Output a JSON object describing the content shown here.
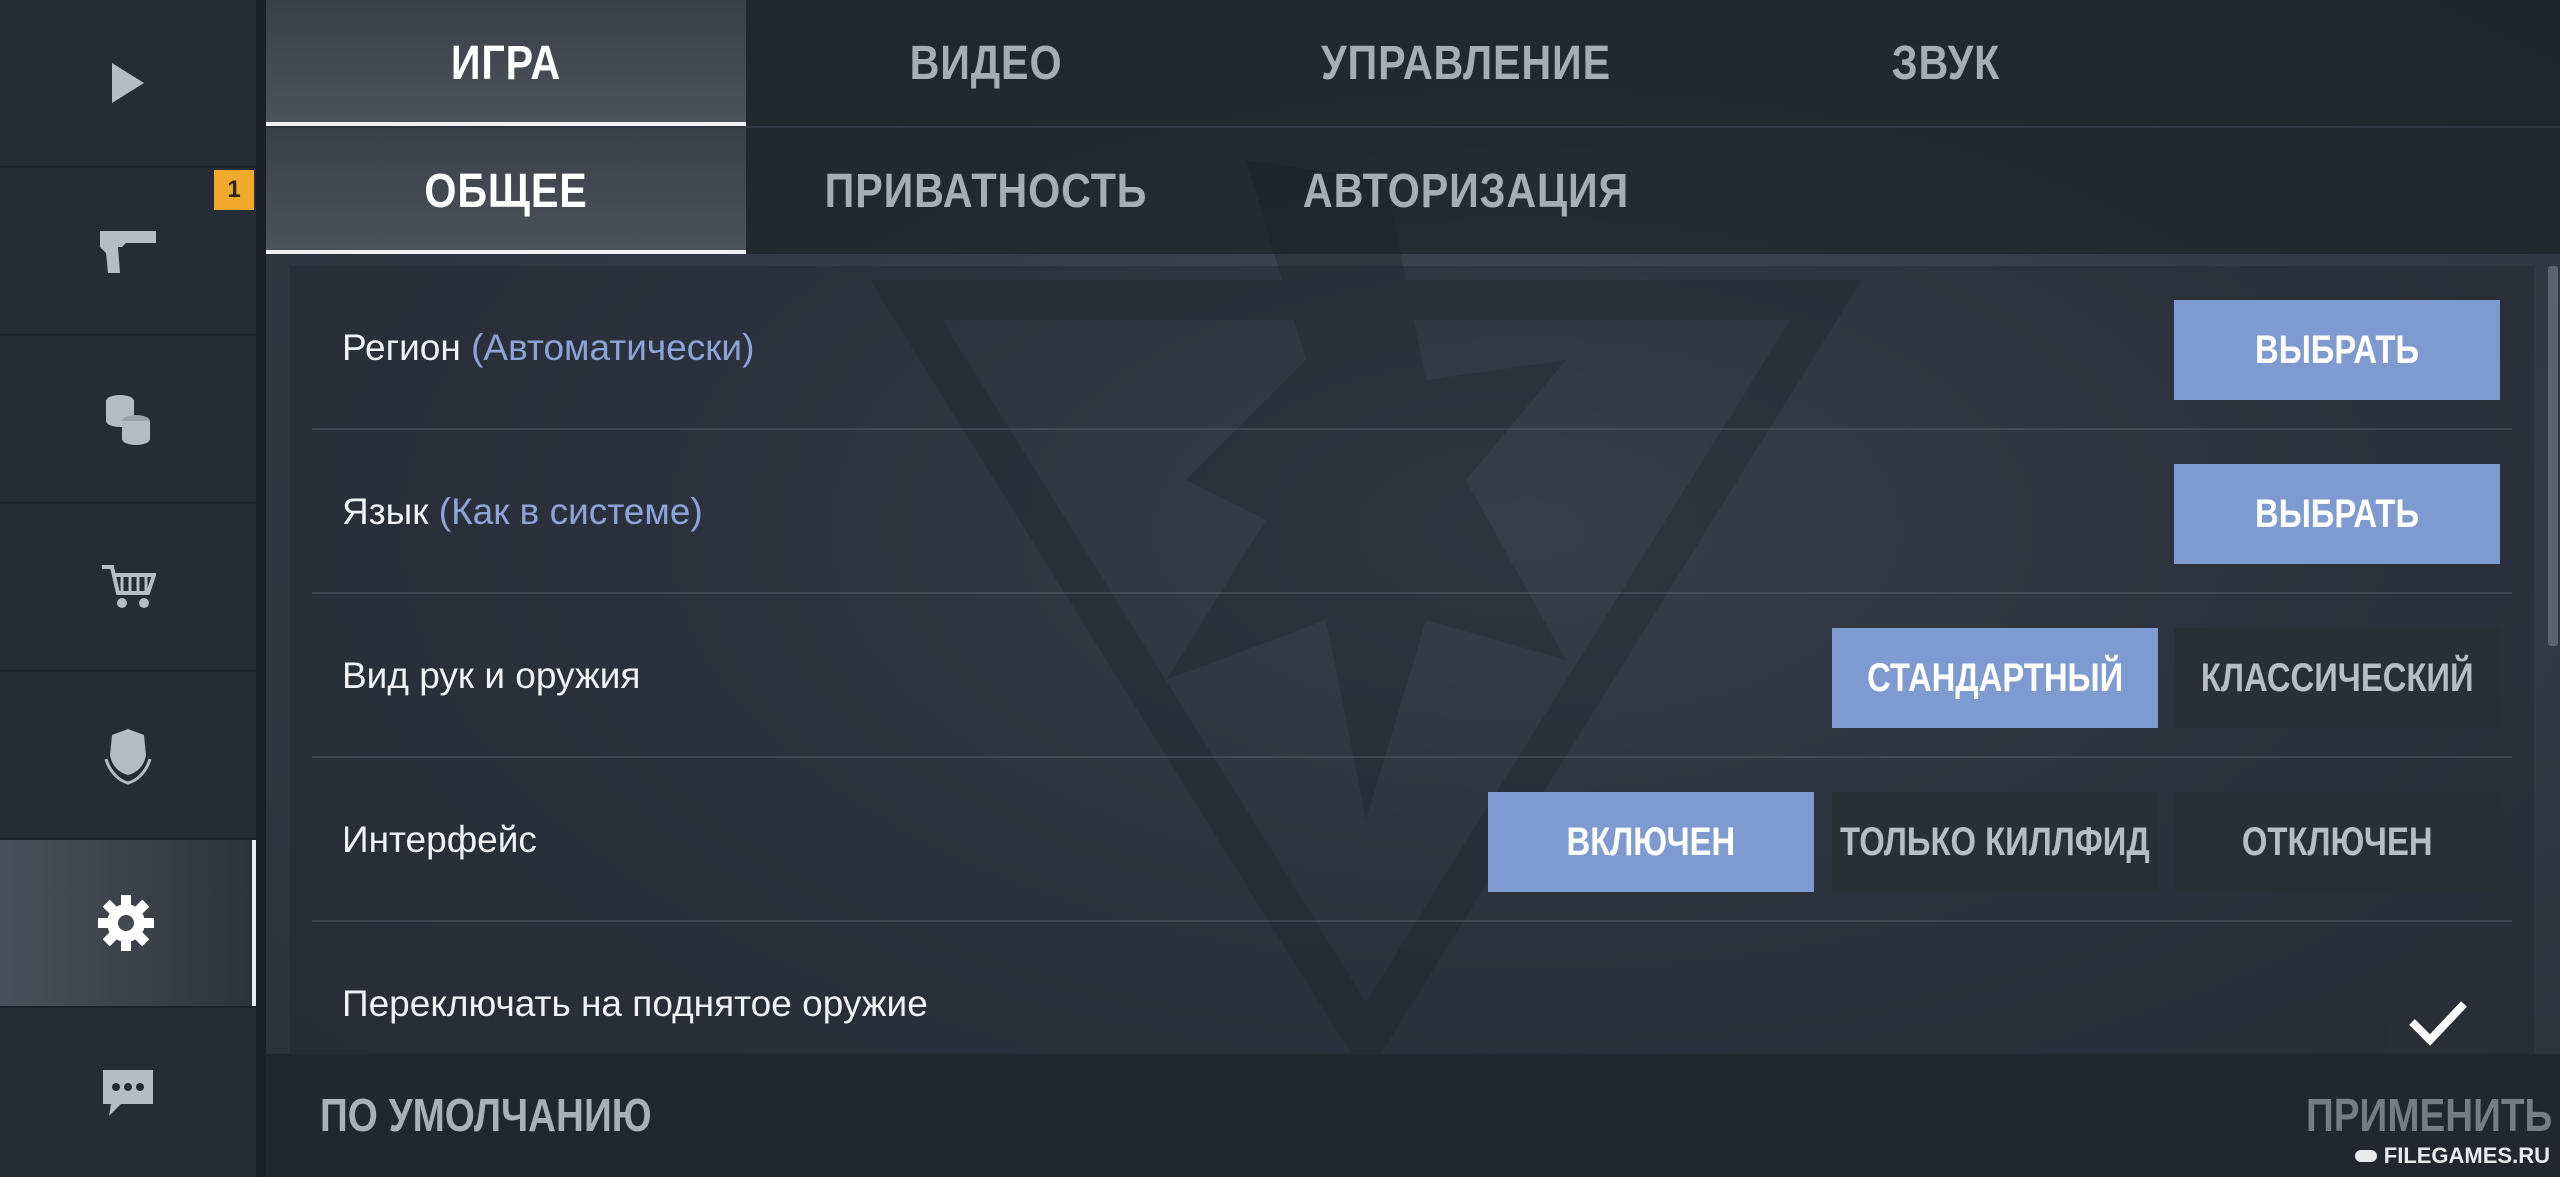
{
  "sidebar": {
    "items": [
      {
        "icon": "play-icon"
      },
      {
        "icon": "pistol-icon",
        "badge": "1"
      },
      {
        "icon": "coins-icon"
      },
      {
        "icon": "cart-icon"
      },
      {
        "icon": "clan-shield-icon"
      },
      {
        "icon": "gear-icon",
        "active": true
      },
      {
        "icon": "chat-icon"
      }
    ]
  },
  "tabs": {
    "main": [
      "ИГРА",
      "ВИДЕО",
      "УПРАВЛЕНИЕ",
      "ЗВУК"
    ],
    "sub": [
      "ОБЩЕЕ",
      "ПРИВАТНОСТЬ",
      "АВТОРИЗАЦИЯ"
    ]
  },
  "settings": {
    "region": {
      "label": "Регион",
      "hint": "(Автоматически)",
      "button": "ВЫБРАТЬ"
    },
    "language": {
      "label": "Язык",
      "hint": "(Как в системе)",
      "button": "ВЫБРАТЬ"
    },
    "hands": {
      "label": "Вид рук и оружия",
      "options": [
        "СТАНДАРТНЫЙ",
        "КЛАССИЧЕСКИЙ"
      ],
      "selected": "СТАНДАРТНЫЙ"
    },
    "interface": {
      "label": "Интерфейс",
      "options": [
        "ВКЛЮЧЕН",
        "ТОЛЬКО КИЛЛФИД",
        "ОТКЛЮЧЕН"
      ],
      "selected": "ВКЛЮЧЕН"
    },
    "switch_weapon": {
      "label": "Переключать на поднятое оружие",
      "checked": true
    }
  },
  "footer": {
    "default_label": "ПО УМОЛЧАНИЮ",
    "apply_label": "ПРИМЕНИТЬ"
  },
  "watermark": "FILEGAMES.RU",
  "colors": {
    "accent": "#7f9ad1",
    "badge": "#f0a92a",
    "hint": "#8ea4d8"
  }
}
